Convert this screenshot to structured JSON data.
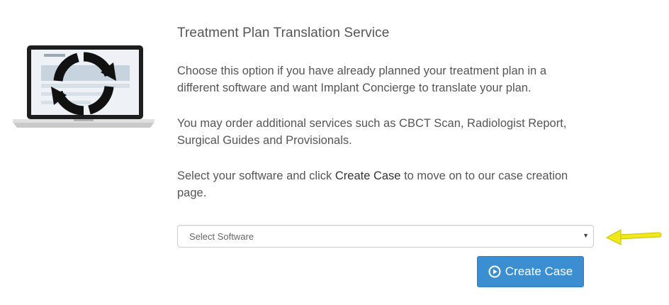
{
  "service": {
    "title": "Treatment Plan Translation Service",
    "paragraph1": "Choose this option if you have already planned your treatment plan in a different software and want Implant Concierge to translate your plan.",
    "paragraph2": "You may order additional services such as CBCT Scan, Radiologist Report, Surgical Guides and Provisionals.",
    "paragraph3_before": "Select your software and click ",
    "paragraph3_strong": "Create Case",
    "paragraph3_after": " to move on to our case creation page."
  },
  "software_select": {
    "selected": "Select Software"
  },
  "create_button": {
    "label": "Create Case",
    "icon": "play-circle-icon"
  },
  "illustration": {
    "icon": "refresh-icon",
    "image": "laptop-image"
  },
  "colors": {
    "button": "#3b8fd1",
    "arrow": "#f0e81b",
    "text": "#555555"
  }
}
